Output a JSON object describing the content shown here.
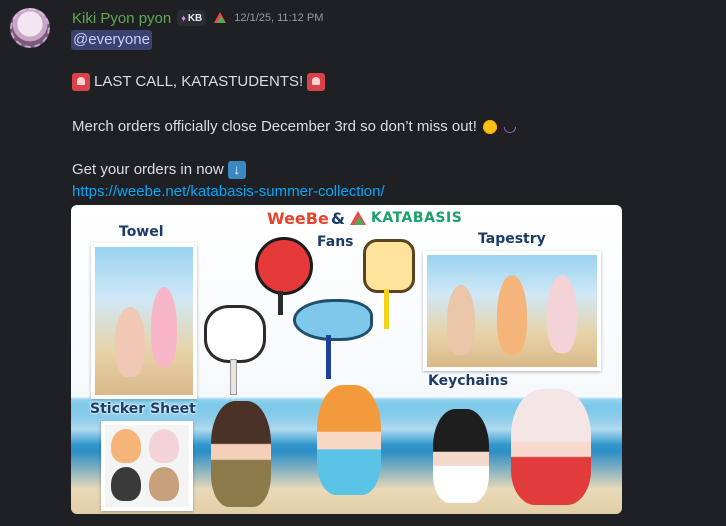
{
  "message": {
    "username": "Kiki Pyon pyon",
    "tag": {
      "icon": "gem-icon",
      "text": "KB"
    },
    "timestamp": "12/1/25, 11:12 PM",
    "mention": "@everyone",
    "line1": "LAST CALL, KATASTUDENTS!",
    "line2": "Merch orders officially close December 3rd so don’t miss out!",
    "line3": "Get your orders in now",
    "link": "https://weebe.net/katabasis-summer-collection/"
  },
  "banner": {
    "brand_left": "WeeBe",
    "brand_amp": "&",
    "brand_right": "KATABASIS",
    "labels": {
      "towel": "Towel",
      "fans": "Fans",
      "tapestry": "Tapestry",
      "keychains": "Keychains",
      "sticker_sheet": "Sticker Sheet"
    }
  },
  "colors": {
    "background": "#1f2024",
    "username": "#5ea84f",
    "link": "#00a8fc",
    "mention_bg": "#3c4270",
    "mention_text": "#c9cdfb"
  }
}
